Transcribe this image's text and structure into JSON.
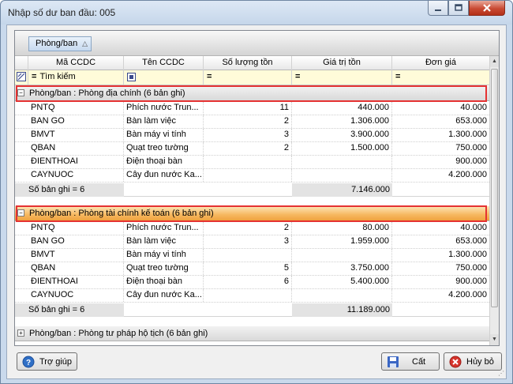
{
  "window": {
    "title": "Nhập số dư ban đầu: 005"
  },
  "grouping": {
    "chip_label": "Phòng/ban"
  },
  "columns": [
    "Mã CCDC",
    "Tên CCDC",
    "Số lượng tồn",
    "Giá trị tồn",
    "Đơn giá"
  ],
  "filter": {
    "eq": "=",
    "search_label": "Tìm kiếm"
  },
  "groups": [
    {
      "title": "Phòng/ban : Phòng địa chính (6 bản ghi)",
      "expanded": true,
      "rows": [
        [
          "PNTQ",
          "Phích nước Trun...",
          "11",
          "440.000",
          "40.000"
        ],
        [
          "BAN GO",
          "Bàn làm việc",
          "2",
          "1.306.000",
          "653.000"
        ],
        [
          "BMVT",
          "Bàn máy vi tính",
          "3",
          "3.900.000",
          "1.300.000"
        ],
        [
          "QBAN",
          "Quạt treo tường",
          "2",
          "1.500.000",
          "750.000"
        ],
        [
          "ĐIENTHOAI",
          "Điện thoại bàn",
          "",
          "",
          "900.000"
        ],
        [
          "CAYNUOC",
          "Cây đun nước Ka...",
          "",
          "",
          "4.200.000"
        ]
      ],
      "summary_label": "Số bản ghi = 6",
      "summary_total": "7.146.000"
    },
    {
      "title": "Phòng/ban : Phòng tài chính kế toán (6 bản ghi)",
      "expanded": true,
      "rows": [
        [
          "PNTQ",
          "Phích nước Trun...",
          "2",
          "80.000",
          "40.000"
        ],
        [
          "BAN GO",
          "Bàn làm việc",
          "3",
          "1.959.000",
          "653.000"
        ],
        [
          "BMVT",
          "Bàn máy vi tính",
          "",
          "",
          "1.300.000"
        ],
        [
          "QBAN",
          "Quạt treo tường",
          "5",
          "3.750.000",
          "750.000"
        ],
        [
          "ĐIENTHOAI",
          "Điện thoại bàn",
          "6",
          "5.400.000",
          "900.000"
        ],
        [
          "CAYNUOC",
          "Cây đun nước Ka...",
          "",
          "",
          "4.200.000"
        ]
      ],
      "summary_label": "Số bản ghi = 6",
      "summary_total": "11.189.000"
    },
    {
      "title": "Phòng/ban : Phòng tư pháp hộ tịch (6 bản ghi)",
      "expanded": false
    }
  ],
  "buttons": {
    "help": "Trợ giúp",
    "save": "Cất",
    "cancel": "Hủy bỏ"
  },
  "colors": {
    "highlight_box": "#e53232",
    "selected_group": "#f6b860"
  }
}
